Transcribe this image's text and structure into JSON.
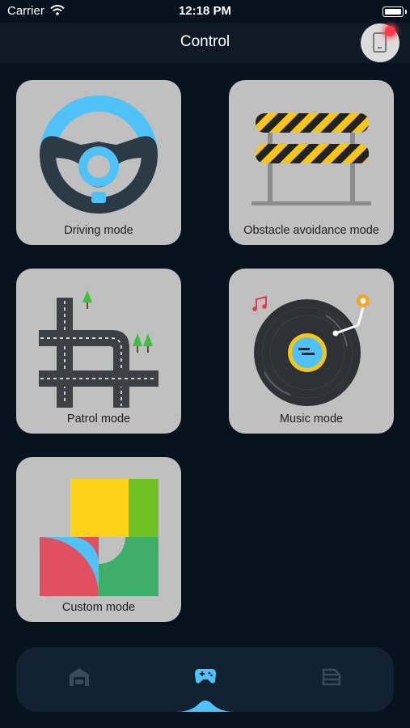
{
  "status_bar": {
    "carrier": "Carrier",
    "time": "12:18 PM"
  },
  "nav": {
    "title": "Control"
  },
  "cards": [
    {
      "label": "Driving mode",
      "icon": "steering-wheel-icon"
    },
    {
      "label": "Obstacle avoidance mode",
      "icon": "road-barrier-icon"
    },
    {
      "label": "Patrol mode",
      "icon": "road-map-icon"
    },
    {
      "label": "Music mode",
      "icon": "vinyl-record-icon"
    },
    {
      "label": "Custom mode",
      "icon": "color-blocks-icon"
    }
  ],
  "tabbar": {
    "active_index": 1,
    "items": [
      {
        "icon": "garage-icon"
      },
      {
        "icon": "gamepad-icon"
      },
      {
        "icon": "layers-icon"
      }
    ]
  },
  "colors": {
    "background": "#07121f",
    "navbar": "#0f1a26",
    "card": "#c0c0c0",
    "accent": "#4fc3f7",
    "notification_dot": "#ff3b4a"
  }
}
